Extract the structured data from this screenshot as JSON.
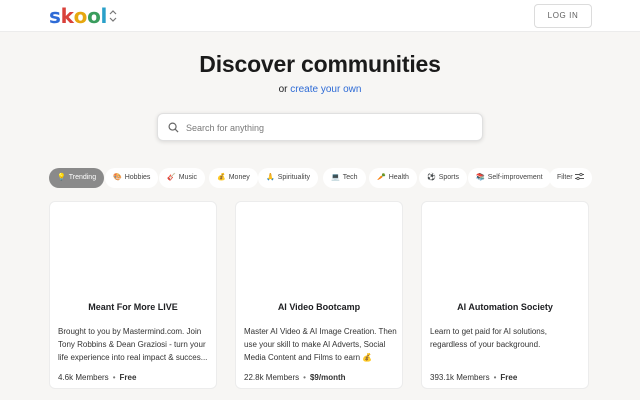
{
  "header": {
    "logo_letters": [
      {
        "char": "s",
        "color": "#2e6bd6"
      },
      {
        "char": "k",
        "color": "#d9413a"
      },
      {
        "char": "o",
        "color": "#e6a70f"
      },
      {
        "char": "o",
        "color": "#3a9d5d"
      },
      {
        "char": "l",
        "color": "#2aa0c9"
      }
    ],
    "login_label": "LOG IN"
  },
  "hero": {
    "title": "Discover communities",
    "subtitle_prefix": "or",
    "subtitle_link": "create your own"
  },
  "search": {
    "placeholder": "Search for anything"
  },
  "categories": [
    {
      "icon": "💡",
      "label": "Trending",
      "active": true
    },
    {
      "icon": "🎨",
      "label": "Hobbies"
    },
    {
      "icon": "🎸",
      "label": "Music"
    },
    {
      "icon": "💰",
      "label": "Money"
    },
    {
      "icon": "🙏",
      "label": "Spirituality"
    },
    {
      "icon": "💻",
      "label": "Tech"
    },
    {
      "icon": "🥕",
      "label": "Health"
    },
    {
      "icon": "⚽",
      "label": "Sports"
    },
    {
      "icon": "📚",
      "label": "Self-improvement"
    },
    {
      "label": "Filter"
    }
  ],
  "communities": [
    {
      "name": "Meant For More LIVE",
      "description": "Brought to you by Mastermind.com. Join Tony Robbins & Dean Graziosi - turn your life experience into real impact & succes...",
      "members": "4.6k Members",
      "price": "Free"
    },
    {
      "name": "AI Video Bootcamp",
      "description": "Master AI Video & AI Image Creation. Then use your skill to make AI Adverts, Social Media Content and Films to earn 💰",
      "members": "22.8k Members",
      "price": "$9/month"
    },
    {
      "name": "AI Automation Society",
      "description": "Learn to get paid for AI solutions, regardless of your background.",
      "members": "393.1k Members",
      "price": "Free"
    }
  ],
  "meta_separator": "•"
}
